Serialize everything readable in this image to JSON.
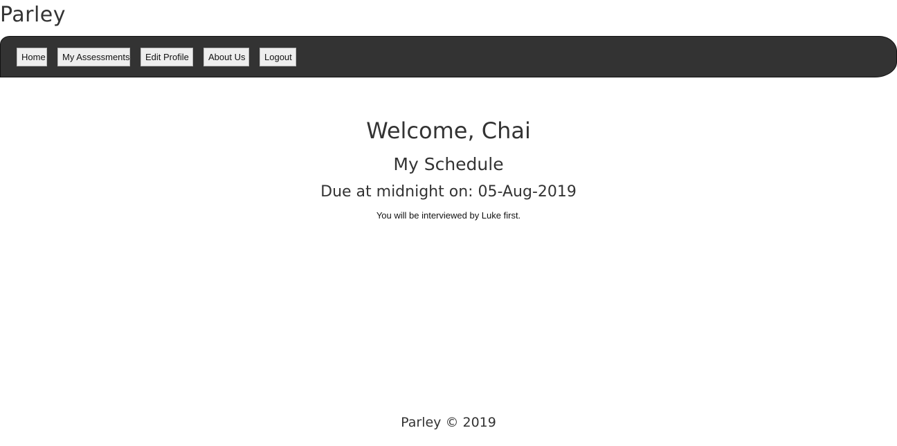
{
  "site": {
    "title": "Parley"
  },
  "nav": {
    "items": [
      {
        "label": "Home"
      },
      {
        "label": "My Assessments"
      },
      {
        "label": "Edit Profile"
      },
      {
        "label": "About Us"
      },
      {
        "label": "Logout"
      }
    ]
  },
  "main": {
    "welcome": "Welcome, Chai",
    "schedule_heading": "My Schedule",
    "due_text": "Due at midnight on: 05-Aug-2019",
    "interview_text": "You will be interviewed by Luke first."
  },
  "footer": {
    "text": "Parley © 2019"
  },
  "colors": {
    "navbar_bg": "#333333",
    "nav_button_bg": "#eeeeee",
    "text": "#333333"
  }
}
